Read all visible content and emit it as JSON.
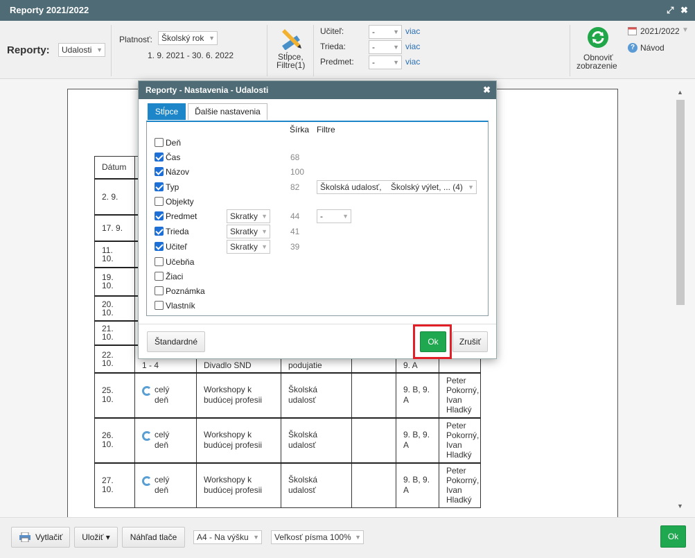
{
  "window": {
    "title": "Reporty 2021/2022",
    "expand_glyph": "⤢",
    "close_glyph": "✖"
  },
  "toolbar": {
    "reporty_label": "Reporty:",
    "report_type": "Udalosti",
    "platnost_label": "Platnosť:",
    "platnost_value": "Školský rok",
    "date_range": "1. 9. 2021 - 30. 6. 2022",
    "columns_filter_label_1": "Stĺpce,",
    "columns_filter_label_2": "Filtre(1)",
    "ucitel_label": "Učiteľ:",
    "trieda_label": "Trieda:",
    "predmet_label": "Predmet:",
    "dash": "-",
    "viac": "viac",
    "refresh_label_1": "Obnoviť",
    "refresh_label_2": "zobrazenie",
    "year": "2021/2022",
    "help": "Návod"
  },
  "report_table": {
    "header": "Dátum",
    "left_dates": [
      "2. 9.",
      "17. 9.",
      "11.\n10.",
      "19.\n10.",
      "20.\n10.",
      "21.\n10.",
      "22.\n10."
    ],
    "partial_row": {
      "time": "1 - 4",
      "name": "Divadlo SND",
      "type": "podujatie",
      "class": "9. A"
    },
    "rows": [
      {
        "date": "25.\n10.",
        "time": "celý\ndeň",
        "name": "Workshopy k budúcej profesii",
        "type": "Školská udalosť",
        "class": "9. B, 9. A",
        "teacher": "Peter Pokorný, Ivan Hladký"
      },
      {
        "date": "26.\n10.",
        "time": "celý\ndeň",
        "name": "Workshopy k budúcej profesii",
        "type": "Školská udalosť",
        "class": "9. B, 9. A",
        "teacher": "Peter Pokorný, Ivan Hladký"
      },
      {
        "date": "27.\n10.",
        "time": "celý\ndeň",
        "name": "Workshopy k budúcej profesii",
        "type": "Školská udalosť",
        "class": "9. B, 9. A",
        "teacher": "Peter Pokorný, Ivan Hladký"
      }
    ]
  },
  "dialog": {
    "title": "Reporty - Nastavenia - Udalosti",
    "tabs": [
      "Stĺpce",
      "Ďalšie nastavenia"
    ],
    "col_width_header": "Šírka",
    "col_filter_header": "Filtre",
    "rows": [
      {
        "name": "Deň",
        "checked": false
      },
      {
        "name": "Čas",
        "checked": true,
        "width": "68"
      },
      {
        "name": "Názov",
        "checked": true,
        "width": "100"
      },
      {
        "name": "Typ",
        "checked": true,
        "width": "82",
        "filter": "Školská udalosť,    Školský výlet, ... (4)"
      },
      {
        "name": "Objekty",
        "checked": false
      },
      {
        "name": "Predmet",
        "checked": true,
        "width": "44",
        "mode": "Skratky",
        "filter": "-"
      },
      {
        "name": "Trieda",
        "checked": true,
        "width": "41",
        "mode": "Skratky"
      },
      {
        "name": "Učiteľ",
        "checked": true,
        "width": "39",
        "mode": "Skratky"
      },
      {
        "name": "Učebňa",
        "checked": false
      },
      {
        "name": "Žiaci",
        "checked": false
      },
      {
        "name": "Poznámka",
        "checked": false
      },
      {
        "name": "Vlastník",
        "checked": false
      }
    ],
    "standard_btn": "Štandardné",
    "ok_btn": "Ok",
    "cancel_btn": "Zrušiť"
  },
  "footer": {
    "print": "Vytlačiť",
    "save": "Uložiť ▾",
    "preview": "Náhľad tlače",
    "paper": "A4 - Na výšku",
    "font_size": "Veľkosť písma 100%",
    "ok": "Ok"
  },
  "colors": {
    "titlebar": "#4e6b76",
    "accent": "#1d86c8",
    "ok_green": "#1fa84f",
    "highlight": "#e01f26"
  }
}
